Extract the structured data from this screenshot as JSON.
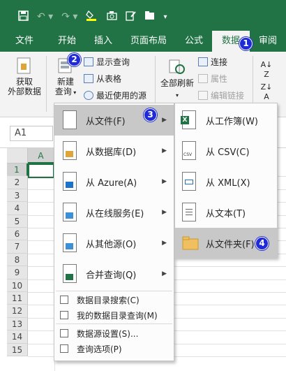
{
  "qat": {
    "save_icon": "save-icon",
    "undo_icon": "undo-icon",
    "redo_icon": "redo-icon"
  },
  "tabs": [
    {
      "label": "文件"
    },
    {
      "label": "开始"
    },
    {
      "label": "插入"
    },
    {
      "label": "页面布局"
    },
    {
      "label": "公式"
    },
    {
      "label": "数据"
    },
    {
      "label": "审阅"
    }
  ],
  "ribbon": {
    "get_external": "获取\n外部数据",
    "new_query": "新建\n查询",
    "show_queries": "显示查询",
    "from_table": "从表格",
    "recent_sources": "最近使用的源",
    "refresh_all": "全部刷新",
    "connections": "连接",
    "properties": "属性",
    "edit_links": "编辑链接"
  },
  "namebox": {
    "value": "A1"
  },
  "grid": {
    "col_a": "A",
    "rows": [
      "1",
      "2",
      "3",
      "4",
      "5",
      "6",
      "7",
      "8",
      "9",
      "10",
      "11",
      "12",
      "13",
      "14",
      "15"
    ]
  },
  "menu": {
    "items": [
      {
        "label": "从文件(F)",
        "icon": "file-icon",
        "submenu": true
      },
      {
        "label": "从数据库(D)",
        "icon": "database-icon",
        "submenu": true
      },
      {
        "label": "从 Azure(A)",
        "icon": "azure-icon",
        "submenu": true
      },
      {
        "label": "从在线服务(E)",
        "icon": "cloud-icon",
        "submenu": true
      },
      {
        "label": "从其他源(O)",
        "icon": "other-source-icon",
        "submenu": true
      },
      {
        "label": "合并查询(Q)",
        "icon": "combine-icon",
        "submenu": true
      }
    ],
    "small_items": [
      {
        "label": "数据目录搜索(C)"
      },
      {
        "label": "我的数据目录查询(M)"
      },
      {
        "label": "数据源设置(S)..."
      },
      {
        "label": "查询选项(P)"
      }
    ]
  },
  "submenu": {
    "items": [
      {
        "label": "从工作簿(W)",
        "icon": "excel-workbook-icon"
      },
      {
        "label": "从 CSV(C)",
        "icon": "csv-icon",
        "tag": "CSV"
      },
      {
        "label": "从 XML(X)",
        "icon": "xml-icon"
      },
      {
        "label": "从文本(T)",
        "icon": "text-file-icon"
      },
      {
        "label": "从文件夹(F)",
        "icon": "folder-icon"
      }
    ]
  },
  "badges": [
    "1",
    "2",
    "3",
    "4"
  ],
  "colors": {
    "accent": "#217346",
    "badge": "#1f2bd6",
    "highlight": "#c8c8c8"
  }
}
